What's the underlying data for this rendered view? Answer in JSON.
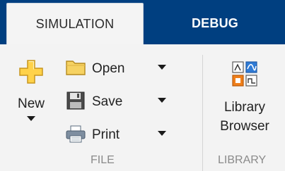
{
  "tabs": [
    {
      "label": "SIMULATION",
      "active": true
    },
    {
      "label": "DEBUG",
      "active": false
    }
  ],
  "file_group": {
    "label": "FILE",
    "new": {
      "label": "New",
      "icon": "new-plus-icon"
    },
    "open": {
      "label": "Open",
      "icon": "folder-icon"
    },
    "save": {
      "label": "Save",
      "icon": "floppy-disk-icon"
    },
    "print": {
      "label": "Print",
      "icon": "printer-icon"
    }
  },
  "library_group": {
    "label": "LIBRARY",
    "browser": {
      "line1": "Library",
      "line2": "Browser",
      "icon": "library-browser-icon"
    }
  },
  "colors": {
    "tabbar": "#003f80",
    "ribbon": "#f3f3f3",
    "plus_fill": "#ffd24a",
    "folder_fill": "#f6d262",
    "library_blue": "#2f7bd6",
    "library_orange": "#ef7f1a"
  }
}
